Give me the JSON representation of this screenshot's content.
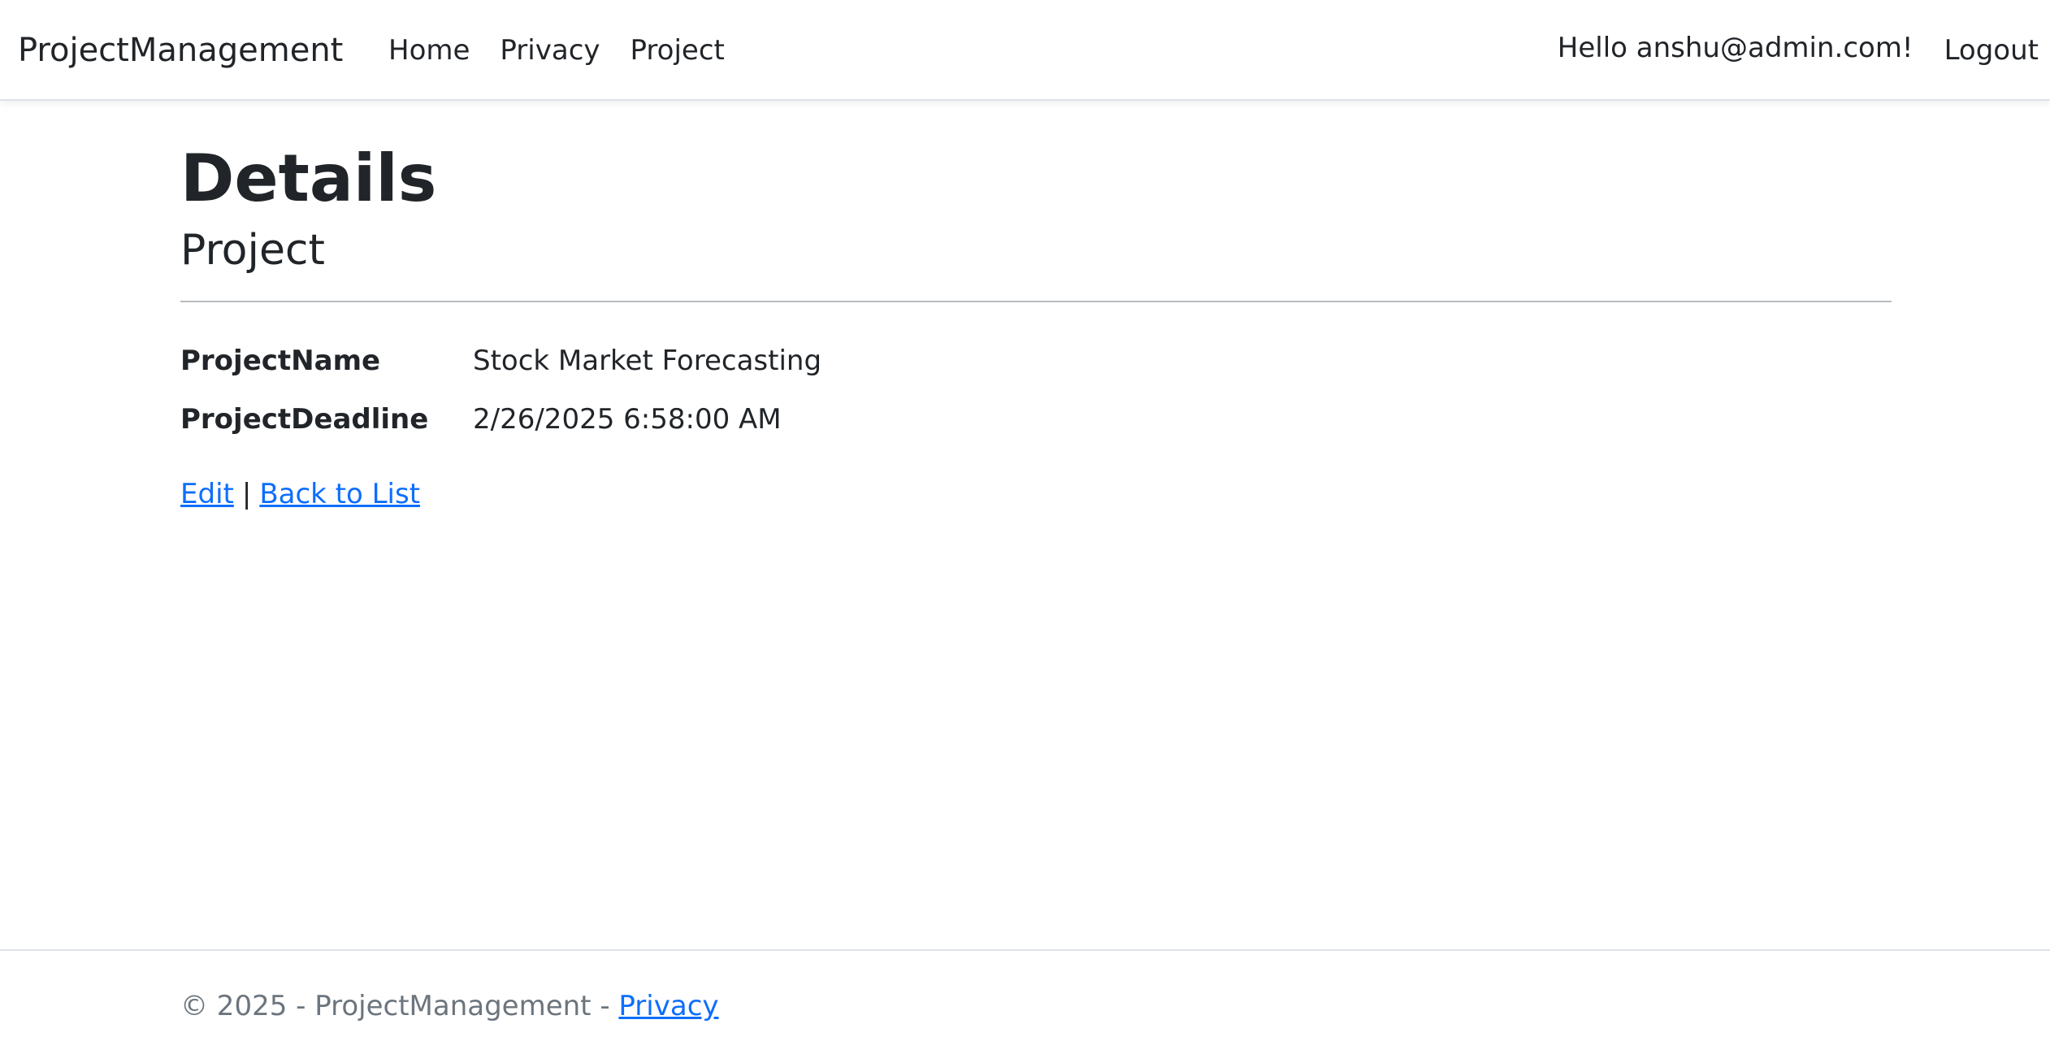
{
  "navbar": {
    "brand": "ProjectManagement",
    "links": [
      {
        "label": "Home"
      },
      {
        "label": "Privacy"
      },
      {
        "label": "Project"
      }
    ],
    "greeting": "Hello anshu@admin.com!",
    "logout_label": "Logout"
  },
  "main": {
    "title": "Details",
    "subtitle": "Project",
    "fields": [
      {
        "label": "ProjectName",
        "value": "Stock Market Forecasting"
      },
      {
        "label": "ProjectDeadline",
        "value": "2/26/2025 6:58:00 AM"
      }
    ],
    "edit_label": "Edit",
    "separator": "|",
    "back_label": "Back to List"
  },
  "footer": {
    "text": "© 2025 - ProjectManagement - ",
    "privacy_label": "Privacy"
  },
  "colors": {
    "link": "#0d6efd",
    "text": "#212529",
    "muted": "#6c757d"
  }
}
